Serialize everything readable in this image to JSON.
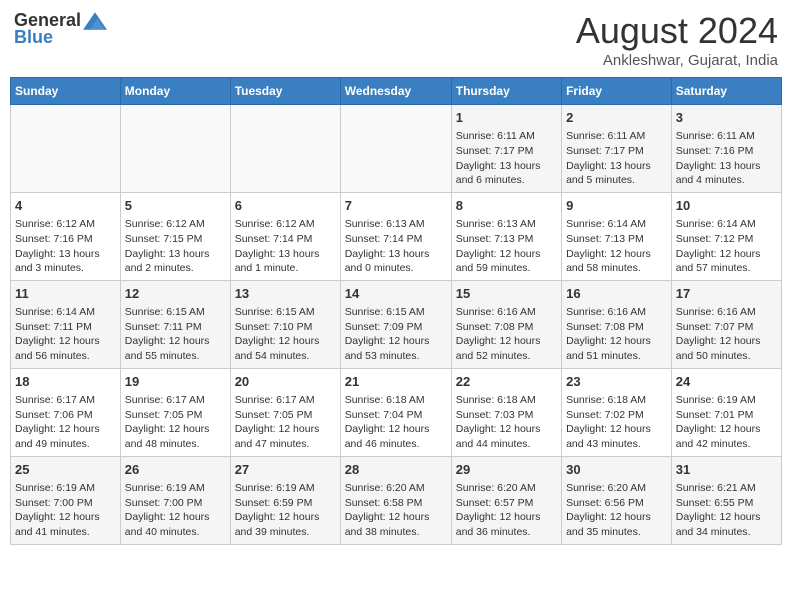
{
  "header": {
    "logo_general": "General",
    "logo_blue": "Blue",
    "month_title": "August 2024",
    "subtitle": "Ankleshwar, Gujarat, India"
  },
  "days_of_week": [
    "Sunday",
    "Monday",
    "Tuesday",
    "Wednesday",
    "Thursday",
    "Friday",
    "Saturday"
  ],
  "weeks": [
    [
      {
        "day": "",
        "info": ""
      },
      {
        "day": "",
        "info": ""
      },
      {
        "day": "",
        "info": ""
      },
      {
        "day": "",
        "info": ""
      },
      {
        "day": "1",
        "info": "Sunrise: 6:11 AM\nSunset: 7:17 PM\nDaylight: 13 hours\nand 6 minutes."
      },
      {
        "day": "2",
        "info": "Sunrise: 6:11 AM\nSunset: 7:17 PM\nDaylight: 13 hours\nand 5 minutes."
      },
      {
        "day": "3",
        "info": "Sunrise: 6:11 AM\nSunset: 7:16 PM\nDaylight: 13 hours\nand 4 minutes."
      }
    ],
    [
      {
        "day": "4",
        "info": "Sunrise: 6:12 AM\nSunset: 7:16 PM\nDaylight: 13 hours\nand 3 minutes."
      },
      {
        "day": "5",
        "info": "Sunrise: 6:12 AM\nSunset: 7:15 PM\nDaylight: 13 hours\nand 2 minutes."
      },
      {
        "day": "6",
        "info": "Sunrise: 6:12 AM\nSunset: 7:14 PM\nDaylight: 13 hours\nand 1 minute."
      },
      {
        "day": "7",
        "info": "Sunrise: 6:13 AM\nSunset: 7:14 PM\nDaylight: 13 hours\nand 0 minutes."
      },
      {
        "day": "8",
        "info": "Sunrise: 6:13 AM\nSunset: 7:13 PM\nDaylight: 12 hours\nand 59 minutes."
      },
      {
        "day": "9",
        "info": "Sunrise: 6:14 AM\nSunset: 7:13 PM\nDaylight: 12 hours\nand 58 minutes."
      },
      {
        "day": "10",
        "info": "Sunrise: 6:14 AM\nSunset: 7:12 PM\nDaylight: 12 hours\nand 57 minutes."
      }
    ],
    [
      {
        "day": "11",
        "info": "Sunrise: 6:14 AM\nSunset: 7:11 PM\nDaylight: 12 hours\nand 56 minutes."
      },
      {
        "day": "12",
        "info": "Sunrise: 6:15 AM\nSunset: 7:11 PM\nDaylight: 12 hours\nand 55 minutes."
      },
      {
        "day": "13",
        "info": "Sunrise: 6:15 AM\nSunset: 7:10 PM\nDaylight: 12 hours\nand 54 minutes."
      },
      {
        "day": "14",
        "info": "Sunrise: 6:15 AM\nSunset: 7:09 PM\nDaylight: 12 hours\nand 53 minutes."
      },
      {
        "day": "15",
        "info": "Sunrise: 6:16 AM\nSunset: 7:08 PM\nDaylight: 12 hours\nand 52 minutes."
      },
      {
        "day": "16",
        "info": "Sunrise: 6:16 AM\nSunset: 7:08 PM\nDaylight: 12 hours\nand 51 minutes."
      },
      {
        "day": "17",
        "info": "Sunrise: 6:16 AM\nSunset: 7:07 PM\nDaylight: 12 hours\nand 50 minutes."
      }
    ],
    [
      {
        "day": "18",
        "info": "Sunrise: 6:17 AM\nSunset: 7:06 PM\nDaylight: 12 hours\nand 49 minutes."
      },
      {
        "day": "19",
        "info": "Sunrise: 6:17 AM\nSunset: 7:05 PM\nDaylight: 12 hours\nand 48 minutes."
      },
      {
        "day": "20",
        "info": "Sunrise: 6:17 AM\nSunset: 7:05 PM\nDaylight: 12 hours\nand 47 minutes."
      },
      {
        "day": "21",
        "info": "Sunrise: 6:18 AM\nSunset: 7:04 PM\nDaylight: 12 hours\nand 46 minutes."
      },
      {
        "day": "22",
        "info": "Sunrise: 6:18 AM\nSunset: 7:03 PM\nDaylight: 12 hours\nand 44 minutes."
      },
      {
        "day": "23",
        "info": "Sunrise: 6:18 AM\nSunset: 7:02 PM\nDaylight: 12 hours\nand 43 minutes."
      },
      {
        "day": "24",
        "info": "Sunrise: 6:19 AM\nSunset: 7:01 PM\nDaylight: 12 hours\nand 42 minutes."
      }
    ],
    [
      {
        "day": "25",
        "info": "Sunrise: 6:19 AM\nSunset: 7:00 PM\nDaylight: 12 hours\nand 41 minutes."
      },
      {
        "day": "26",
        "info": "Sunrise: 6:19 AM\nSunset: 7:00 PM\nDaylight: 12 hours\nand 40 minutes."
      },
      {
        "day": "27",
        "info": "Sunrise: 6:19 AM\nSunset: 6:59 PM\nDaylight: 12 hours\nand 39 minutes."
      },
      {
        "day": "28",
        "info": "Sunrise: 6:20 AM\nSunset: 6:58 PM\nDaylight: 12 hours\nand 38 minutes."
      },
      {
        "day": "29",
        "info": "Sunrise: 6:20 AM\nSunset: 6:57 PM\nDaylight: 12 hours\nand 36 minutes."
      },
      {
        "day": "30",
        "info": "Sunrise: 6:20 AM\nSunset: 6:56 PM\nDaylight: 12 hours\nand 35 minutes."
      },
      {
        "day": "31",
        "info": "Sunrise: 6:21 AM\nSunset: 6:55 PM\nDaylight: 12 hours\nand 34 minutes."
      }
    ]
  ]
}
